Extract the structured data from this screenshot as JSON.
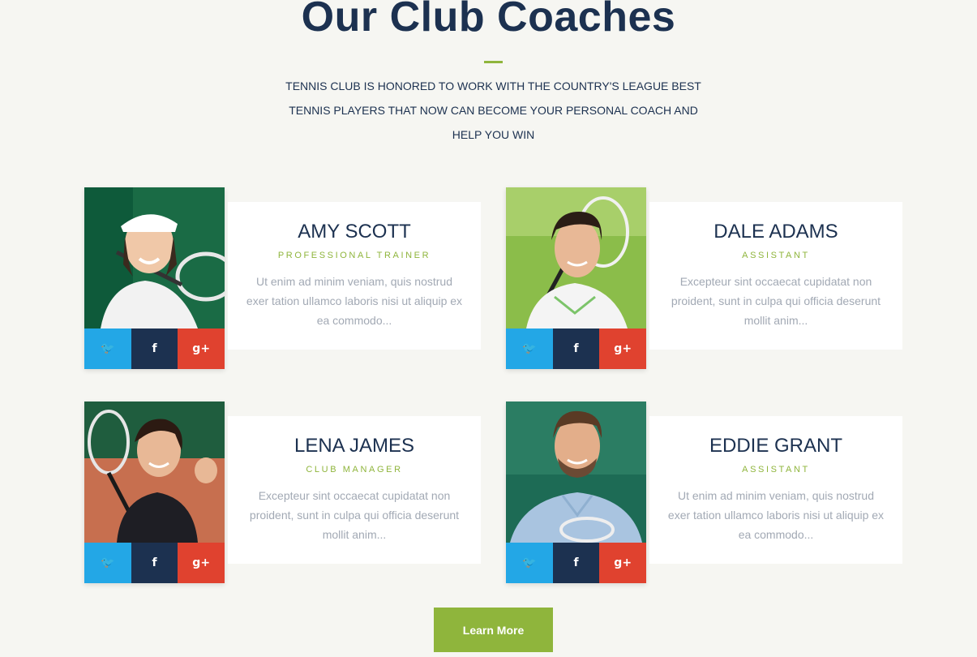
{
  "section": {
    "title": "Our Club Coaches",
    "intro": "TENNIS CLUB IS HONORED TO WORK WITH THE COUNTRY'S LEAGUE BEST TENNIS PLAYERS THAT NOW CAN BECOME YOUR PERSONAL COACH AND HELP YOU WIN"
  },
  "coaches": [
    {
      "name": "AMY SCOTT",
      "role": "PROFESSIONAL TRAINER",
      "bio": "Ut enim ad minim veniam, quis nostrud exer tation ullamco laboris nisi ut aliquip ex ea commodo..."
    },
    {
      "name": "DALE ADAMS",
      "role": "ASSISTANT",
      "bio": "Excepteur sint occaecat cupidatat non proident, sunt in culpa qui officia deserunt mollit anim..."
    },
    {
      "name": "LENA JAMES",
      "role": "CLUB MANAGER",
      "bio": "Excepteur sint occaecat cupidatat non proident, sunt in culpa qui officia deserunt mollit anim..."
    },
    {
      "name": "EDDIE GRANT",
      "role": "ASSISTANT",
      "bio": "Ut enim ad minim veniam, quis nostrud exer tation ullamco laboris nisi ut aliquip ex ea commodo..."
    }
  ],
  "social": {
    "twitter_glyph": "🐦",
    "facebook_glyph": "f",
    "googleplus_glyph": "g+",
    "icons": [
      "twitter-icon",
      "facebook-icon",
      "google-plus-icon"
    ]
  },
  "colors": {
    "accent": "#8fb53c",
    "navy": "#1c3150",
    "twitter": "#23a7e6",
    "googleplus": "#e0422f"
  },
  "cta": {
    "label": "Learn More"
  }
}
